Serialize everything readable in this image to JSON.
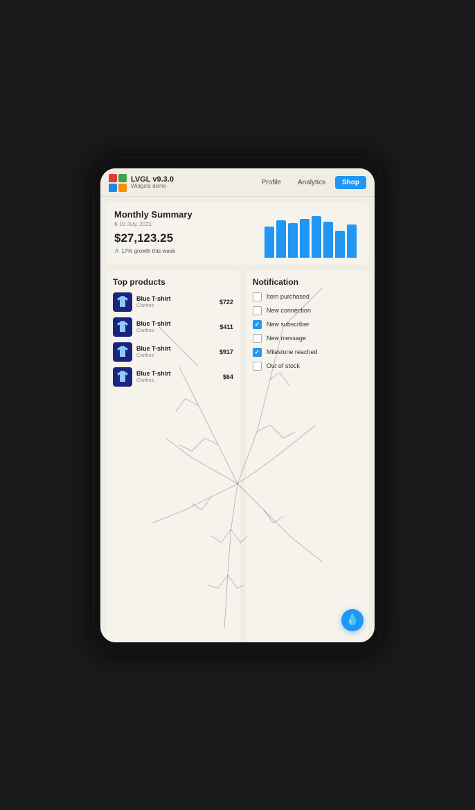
{
  "device": {
    "screen_bg": "#f0ede5"
  },
  "nav": {
    "logo_title": "LVGL v9.3.0",
    "logo_subtitle": "Widgets demo",
    "links": [
      {
        "label": "Profile",
        "active": false
      },
      {
        "label": "Analytics",
        "active": false
      },
      {
        "label": "Shop",
        "active": true
      }
    ]
  },
  "summary": {
    "title": "Monthly Summary",
    "date": "8-15 July, 2021",
    "amount": "$27,123.25",
    "growth_text": "17% growth this week",
    "chart_bars": [
      52,
      62,
      58,
      65,
      70,
      60,
      45,
      55
    ]
  },
  "products": {
    "title": "Top products",
    "items": [
      {
        "name": "Blue T-shirt",
        "category": "Clothes",
        "price": "$722"
      },
      {
        "name": "Blue T-shirt",
        "category": "Clothes",
        "price": "$411"
      },
      {
        "name": "Blue T-shirt",
        "category": "Clothes",
        "price": "$917"
      },
      {
        "name": "Blue T-shirt",
        "category": "Clothes",
        "price": "$64"
      }
    ]
  },
  "notifications": {
    "title": "Notification",
    "items": [
      {
        "label": "Item purchased",
        "checked": false
      },
      {
        "label": "New connection",
        "checked": false
      },
      {
        "label": "New subscriber",
        "checked": true
      },
      {
        "label": "New message",
        "checked": false
      },
      {
        "label": "Milestone reached",
        "checked": true
      },
      {
        "label": "Out of stock",
        "checked": false
      }
    ]
  },
  "fab": {
    "icon": "💧"
  }
}
